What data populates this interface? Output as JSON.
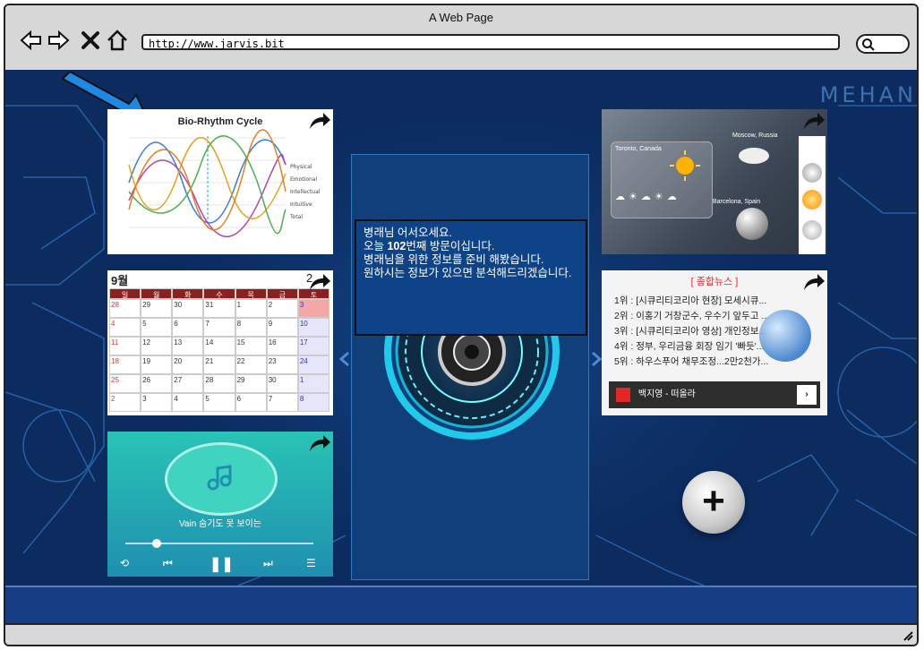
{
  "window": {
    "title": "A Web Page",
    "url": "http://www.jarvis.bit"
  },
  "brand_text": "MEHAN",
  "welcome": {
    "line1": "병래님 어서오세요.",
    "line2_pre": "오늘 ",
    "line2_count": "102",
    "line2_post": "번째 방문이십니다.",
    "line3": "병래님을 위한 정보를 준비 해봤습니다.",
    "line4": "원하시는 정보가 있으면 분석해드리겠습니다."
  },
  "biorhythm": {
    "title": "Bio-Rhythm Cycle",
    "legend": [
      "Physical",
      "Emotional",
      "Intellectual",
      "Intuitive",
      "Total"
    ],
    "colors": [
      "#3a7bd5",
      "#b043b0",
      "#e6a21a",
      "#4caf50",
      "#e67e22"
    ]
  },
  "calendar": {
    "month": "9월",
    "year_fragment": "2",
    "weekdays": [
      "일",
      "월",
      "화",
      "수",
      "목",
      "금",
      "토"
    ],
    "dates": [
      "28",
      "29",
      "30",
      "31",
      "1",
      "2",
      "3",
      "4",
      "5",
      "6",
      "7",
      "8",
      "9",
      "10",
      "11",
      "12",
      "13",
      "14",
      "15",
      "16",
      "17",
      "18",
      "19",
      "20",
      "21",
      "22",
      "23",
      "24",
      "25",
      "26",
      "27",
      "28",
      "29",
      "30",
      "1",
      "2",
      "3",
      "4",
      "5",
      "6",
      "7",
      "8"
    ],
    "colors": {
      "sunday": "#d33",
      "saturday": "#33c",
      "today": "#f4a7a7"
    }
  },
  "weather": {
    "city1": "Toronto, Canada",
    "city2": "Moscow, Russia",
    "city3": "Barcelona, Spain"
  },
  "news": {
    "header": "[ 종합뉴스 ]",
    "items": [
      "1위 : [시큐리티코리아 현장] 모세시큐...",
      "2위 : 이홍기 거창군수, 우수기 앞두고 ...",
      "3위 : [시큐리티코리아 영상] 개인정보...",
      "4위 : 정부, 우리금융 회장 임기 '빠듯'...",
      "5위 : 하우스푸어 채무조정...2만2천가..."
    ],
    "music": "백지영 - 떠올라"
  },
  "player": {
    "track": "Vain 숨기도 못 보이는"
  },
  "add_label": "+"
}
